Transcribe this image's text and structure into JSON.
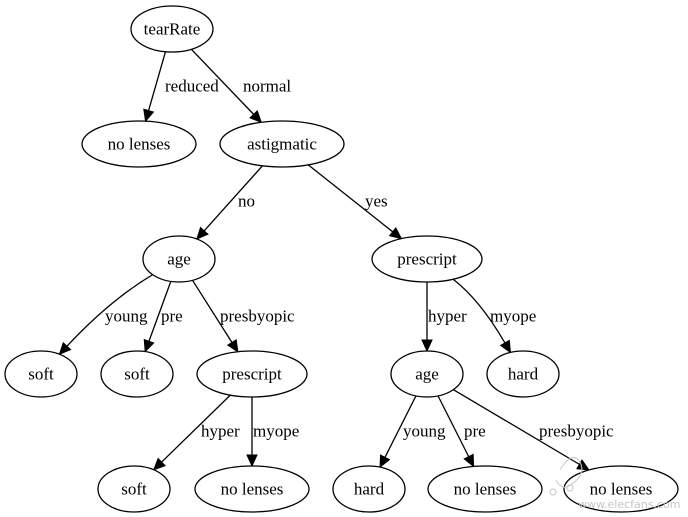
{
  "diagram": {
    "type": "decision-tree",
    "nodes": [
      {
        "id": "tearRate",
        "label": "tearRate",
        "kind": "decision"
      },
      {
        "id": "leaf_nolenses_1",
        "label": "no lenses",
        "kind": "leaf"
      },
      {
        "id": "astigmatic",
        "label": "astigmatic",
        "kind": "decision"
      },
      {
        "id": "age_1",
        "label": "age",
        "kind": "decision"
      },
      {
        "id": "prescript_1",
        "label": "prescript",
        "kind": "decision"
      },
      {
        "id": "leaf_soft_1",
        "label": "soft",
        "kind": "leaf"
      },
      {
        "id": "leaf_soft_2",
        "label": "soft",
        "kind": "leaf"
      },
      {
        "id": "prescript_2",
        "label": "prescript",
        "kind": "decision"
      },
      {
        "id": "age_2",
        "label": "age",
        "kind": "decision"
      },
      {
        "id": "leaf_hard_1",
        "label": "hard",
        "kind": "leaf"
      },
      {
        "id": "leaf_soft_3",
        "label": "soft",
        "kind": "leaf"
      },
      {
        "id": "leaf_nolenses_2",
        "label": "no lenses",
        "kind": "leaf"
      },
      {
        "id": "leaf_hard_2",
        "label": "hard",
        "kind": "leaf"
      },
      {
        "id": "leaf_nolenses_3",
        "label": "no lenses",
        "kind": "leaf"
      },
      {
        "id": "leaf_nolenses_4",
        "label": "no lenses",
        "kind": "leaf"
      }
    ],
    "edges": [
      {
        "from": "tearRate",
        "to": "leaf_nolenses_1",
        "label": "reduced"
      },
      {
        "from": "tearRate",
        "to": "astigmatic",
        "label": "normal"
      },
      {
        "from": "astigmatic",
        "to": "age_1",
        "label": "no"
      },
      {
        "from": "astigmatic",
        "to": "prescript_1",
        "label": "yes"
      },
      {
        "from": "age_1",
        "to": "leaf_soft_1",
        "label": "young"
      },
      {
        "from": "age_1",
        "to": "leaf_soft_2",
        "label": "pre"
      },
      {
        "from": "age_1",
        "to": "prescript_2",
        "label": "presbyopic"
      },
      {
        "from": "prescript_1",
        "to": "age_2",
        "label": "hyper"
      },
      {
        "from": "prescript_1",
        "to": "leaf_hard_1",
        "label": "myope"
      },
      {
        "from": "prescript_2",
        "to": "leaf_soft_3",
        "label": "hyper"
      },
      {
        "from": "prescript_2",
        "to": "leaf_nolenses_2",
        "label": "myope"
      },
      {
        "from": "age_2",
        "to": "leaf_hard_2",
        "label": "young"
      },
      {
        "from": "age_2",
        "to": "leaf_nolenses_3",
        "label": "pre"
      },
      {
        "from": "age_2",
        "to": "leaf_nolenses_4",
        "label": "presbyopic"
      }
    ]
  },
  "watermark": {
    "text": "www.elecfans.com"
  }
}
